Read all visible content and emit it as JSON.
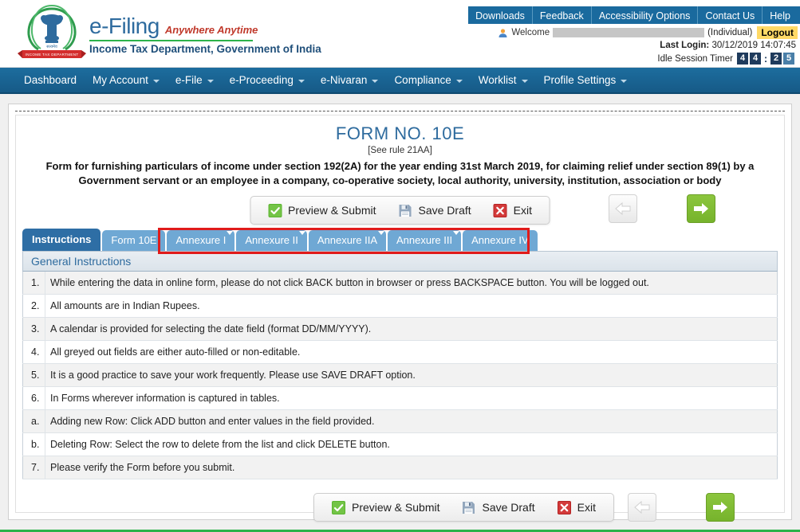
{
  "brand": {
    "efiling": "e-Filing",
    "tagline": "Anywhere Anytime",
    "department": "Income Tax Department, Government of India",
    "emblem_banner": "INCOME TAX DEPARTMENT",
    "accent_blue": "#2e6b9e",
    "accent_green": "#2db34a",
    "accent_red": "#c0392b"
  },
  "top_links": [
    {
      "label": "Downloads"
    },
    {
      "label": "Feedback"
    },
    {
      "label": "Accessibility Options"
    },
    {
      "label": "Contact Us"
    },
    {
      "label": "Help"
    }
  ],
  "session": {
    "welcome_label": "Welcome",
    "user_name": "",
    "user_type": "(Individual)",
    "logout_label": "Logout",
    "last_login_label": "Last Login:",
    "last_login_value": "30/12/2019 14:07:45",
    "idle_timer_label": "Idle Session Timer",
    "timer_digits": [
      "4",
      "4",
      "2",
      "5"
    ],
    "timer_separator": ":",
    "logout_bg": "#ffd966"
  },
  "main_nav": [
    {
      "label": "Dashboard",
      "has_caret": false
    },
    {
      "label": "My Account",
      "has_caret": true
    },
    {
      "label": "e-File",
      "has_caret": true
    },
    {
      "label": "e-Proceeding",
      "has_caret": true
    },
    {
      "label": "e-Nivaran",
      "has_caret": true
    },
    {
      "label": "Compliance",
      "has_caret": true
    },
    {
      "label": "Worklist",
      "has_caret": true
    },
    {
      "label": "Profile Settings",
      "has_caret": true
    }
  ],
  "form": {
    "title": "FORM NO. 10E",
    "rule": "[See rule 21AA]",
    "description": "Form for furnishing particulars of income under section 192(2A) for the year ending 31st March 2019, for claiming relief under section 89(1) by a Government servant or an employee in a company, co-operative society, local authority, university, institution, association or body"
  },
  "toolbar": {
    "preview_submit_label": "Preview & Submit",
    "save_draft_label": "Save Draft",
    "exit_label": "Exit",
    "prev_icon": "arrow-left-icon",
    "next_icon": "arrow-right-icon",
    "prev_enabled": false,
    "next_enabled": true
  },
  "tabs": [
    {
      "label": "Instructions",
      "active": true,
      "caret": false
    },
    {
      "label": "Form 10E",
      "active": false,
      "caret": false
    },
    {
      "label": "Annexure I",
      "active": false,
      "caret": true
    },
    {
      "label": "Annexure II",
      "active": false,
      "caret": true
    },
    {
      "label": "Annexure IIA",
      "active": false,
      "caret": true
    },
    {
      "label": "Annexure III",
      "active": false,
      "caret": true
    },
    {
      "label": "Annexure IV",
      "active": false,
      "caret": false
    }
  ],
  "highlight": {
    "color": "#e01b1b"
  },
  "section": {
    "header": "General Instructions"
  },
  "instructions": [
    {
      "num": "1.",
      "text": "While entering the data in online form, please do not click BACK button in browser or press BACKSPACE button. You will be logged out."
    },
    {
      "num": "2.",
      "text": "All amounts are in Indian Rupees."
    },
    {
      "num": "3.",
      "text": "A calendar is provided for selecting the date field (format DD/MM/YYYY)."
    },
    {
      "num": "4.",
      "text": "All greyed out fields are either auto-filled or non-editable."
    },
    {
      "num": "5.",
      "text": "It is a good practice to save your work frequently. Please use SAVE DRAFT option."
    },
    {
      "num": "6.",
      "text": "In Forms wherever information is captured in tables."
    },
    {
      "num": "a.",
      "text": "Adding new Row: Click ADD button and enter values in the field provided."
    },
    {
      "num": "b.",
      "text": "Deleting Row: Select the row to delete from the list and click DELETE button."
    },
    {
      "num": "7.",
      "text": "Please verify the Form before you submit."
    }
  ]
}
